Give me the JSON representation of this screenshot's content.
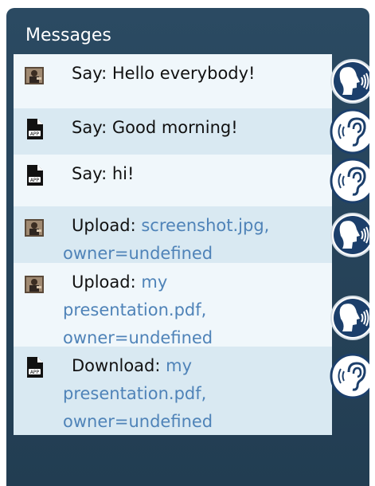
{
  "panel": {
    "title": "Messages"
  },
  "messages": [
    {
      "sender_icon": "user-avatar-icon",
      "status_icon": "speaking-head-icon",
      "kind": "Say:",
      "text": "Hello everybody!",
      "shade": "light"
    },
    {
      "sender_icon": "app-file-icon",
      "status_icon": "listening-ear-icon",
      "kind": "Say:",
      "text": "Good morning!",
      "shade": "dark"
    },
    {
      "sender_icon": "app-file-icon",
      "status_icon": "listening-ear-icon",
      "kind": "Say:",
      "text": "hi!",
      "shade": "light"
    },
    {
      "sender_icon": "user-avatar-icon",
      "status_icon": "speaking-head-icon",
      "kind": "Upload:",
      "link": "screenshot.jpg,",
      "owner": "owner=undefined",
      "shade": "dark"
    },
    {
      "sender_icon": "user-avatar-icon",
      "status_icon": "speaking-head-icon",
      "kind": "Upload:",
      "link": "my",
      "link_line2": "presentation.pdf,",
      "owner": "owner=undefined",
      "shade": "light"
    },
    {
      "sender_icon": "app-file-icon",
      "status_icon": "listening-ear-icon",
      "kind": "Download:",
      "link": "my",
      "link_line2": "presentation.pdf,",
      "owner": "owner=undefined",
      "shade": "dark"
    }
  ],
  "colors": {
    "panel_bg": "#2b4a62",
    "row_light": "#f0f7fb",
    "row_dark": "#d9e9f2",
    "link_text": "#4f83b8",
    "speak_button": "#1c3f6b",
    "listen_button": "#ffffff"
  }
}
